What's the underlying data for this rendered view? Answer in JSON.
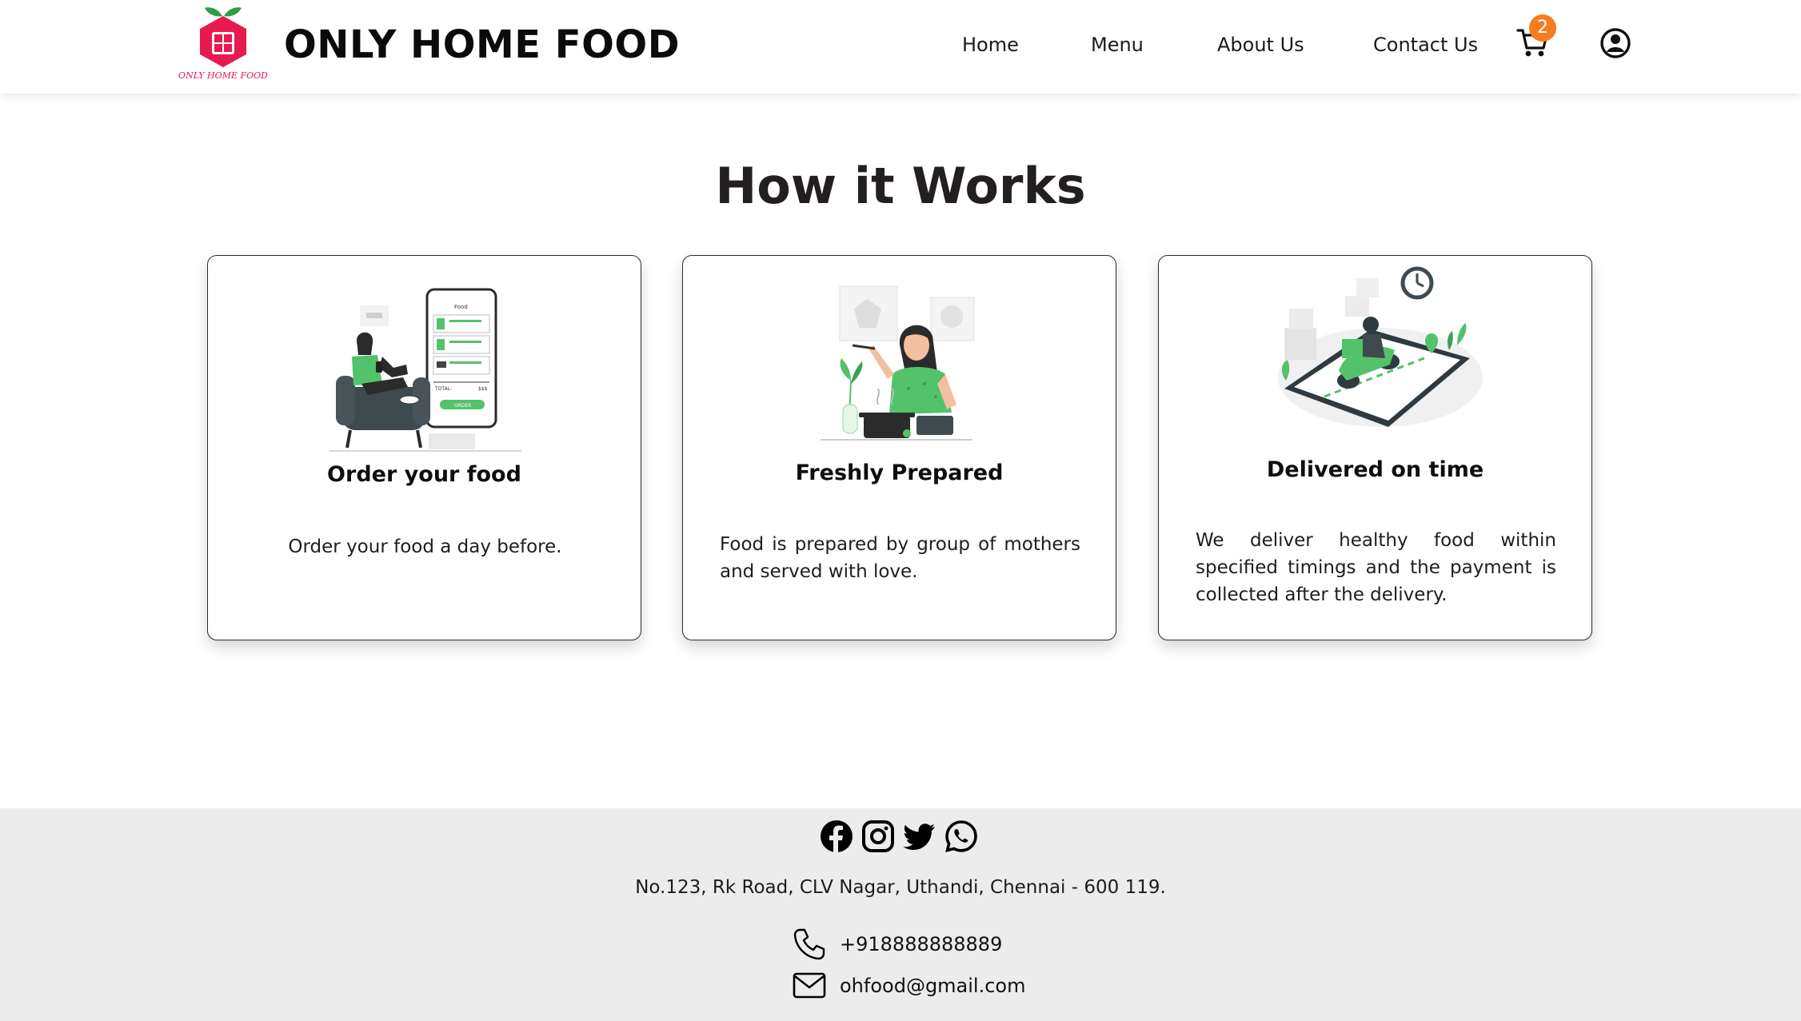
{
  "header": {
    "logo_caption": "ONLY HOME FOOD",
    "brand": "ONLY HOME FOOD",
    "nav": [
      {
        "label": "Home"
      },
      {
        "label": "Menu"
      },
      {
        "label": "About Us"
      },
      {
        "label": "Contact Us"
      }
    ],
    "cart_count": "2",
    "icons": [
      "logo-icon",
      "cart-icon",
      "user-account-icon"
    ]
  },
  "main": {
    "title": "How it Works",
    "cards": [
      {
        "title": "Order your food",
        "text": "Order your food a day before.",
        "illustration": "woman-ordering-on-phone-illustration"
      },
      {
        "title": "Freshly Prepared",
        "text": "Food is prepared by group of mothers and served with love.",
        "illustration": "woman-cooking-illustration"
      },
      {
        "title": "Delivered on time",
        "text": "We deliver healthy food within specified timings and the payment is collected after the delivery.",
        "illustration": "scooter-delivery-on-phone-illustration"
      }
    ]
  },
  "footer": {
    "socials": [
      "facebook-icon",
      "instagram-icon",
      "twitter-icon",
      "whatsapp-icon"
    ],
    "address": "No.123, Rk Road, CLV Nagar, Uthandi, Chennai - 600 119.",
    "phone": "+918888888889",
    "email": "ohfood@gmail.com"
  },
  "colors": {
    "accent_green": "#52c26b",
    "logo_red": "#e8194f",
    "badge_orange": "#f57c1f",
    "footer_bg": "#ececec"
  }
}
